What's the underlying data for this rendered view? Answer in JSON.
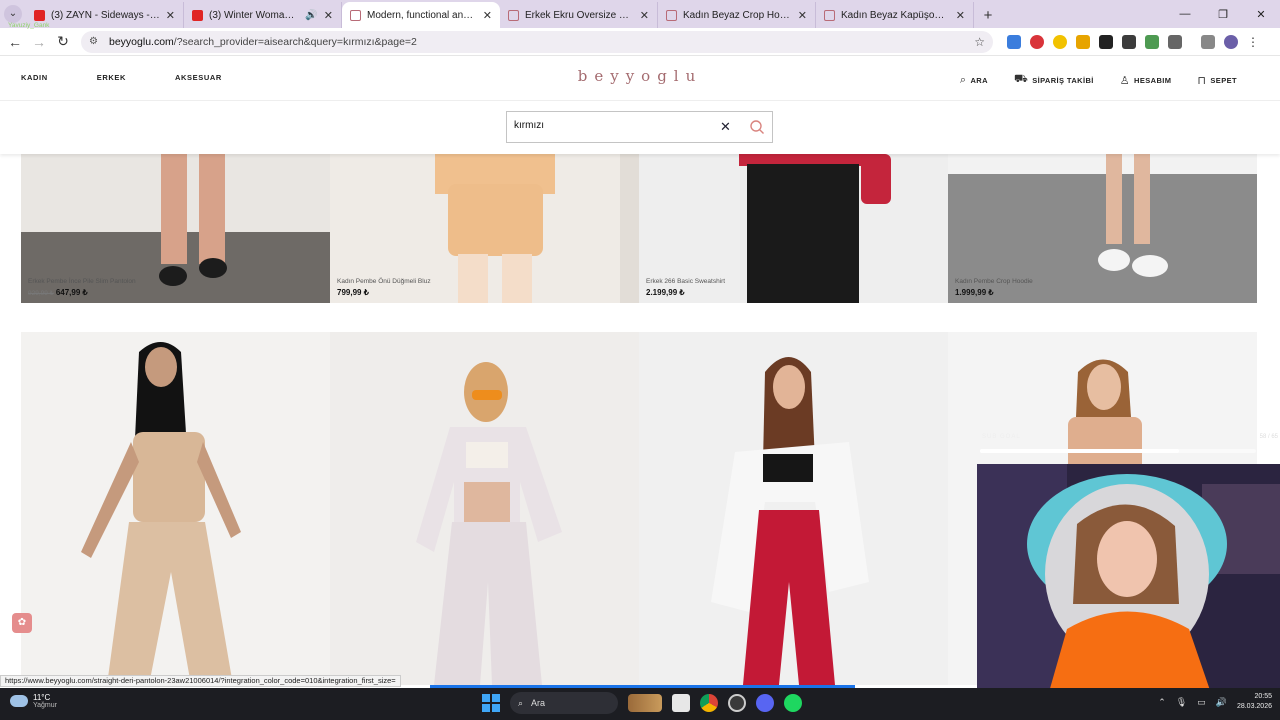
{
  "browser": {
    "tabs": [
      {
        "title": "(3) ZAYN - Sideways - YouTube",
        "favicon": "youtube-icon",
        "active": false,
        "sound": false
      },
      {
        "title": "(3) Winter Woman. - YouTube",
        "favicon": "youtube-icon",
        "active": false,
        "sound": true
      },
      {
        "title": "Modern, functional and cool - beyyoglu",
        "favicon": "beyyoglu-icon",
        "active": true,
        "sound": false
      },
      {
        "title": "Erkek Ekru Oversize Hoodie | Beyyoglu",
        "favicon": "beyyoglu-icon",
        "active": false,
        "sound": false
      },
      {
        "title": "Kadın Beyaz Crop Hoodie | Beyyoglu",
        "favicon": "beyyoglu-icon",
        "active": false,
        "sound": false
      },
      {
        "title": "Kadın Beyaz Kapüşonlu Hoodie",
        "favicon": "beyyoglu-icon",
        "active": false,
        "sound": false
      }
    ],
    "new_tab_label": "+",
    "address": {
      "domain": "beyyoglu.com",
      "path": "/?search_provider=aisearch&query=kırmızı&page=2"
    },
    "status_url": "https://www.beyyoglu.com/straight-deri-pantolon-23aw21006014/?integration_color_code=010&integration_first_size="
  },
  "site": {
    "brand": "beyyoglu",
    "brand_color": "#a46b6f",
    "nav_left": [
      "KADIN",
      "ERKEK",
      "AKSESUAR"
    ],
    "nav_right": {
      "search": "ARA",
      "order_tracking": "SİPARİŞ TAKİBİ",
      "account": "HESABIM",
      "cart": "SEPET"
    },
    "search": {
      "value": "kırmızı"
    }
  },
  "products_row1": [
    {
      "name": "Erkek Pembe İnce Pile Slim Pantolon",
      "old_price": "929,99 ₺",
      "price": "647,99 ₺"
    },
    {
      "name": "Kadın Pembe Önü Düğmeli Bluz",
      "old_price": "",
      "price": "799,99 ₺"
    },
    {
      "name": "Erkek 266 Basic Sweatshirt",
      "old_price": "",
      "price": "2.199,99 ₺"
    },
    {
      "name": "Kadın Pembe Crop Hoodie",
      "old_price": "",
      "price": "1.999,99 ₺"
    }
  ],
  "overlay": {
    "label": "SUB GOAL",
    "count": "58 / 65",
    "progress": 0.72
  },
  "taskbar": {
    "temperature": "11°C",
    "weather": "Yağmur",
    "search_label": "Ara",
    "date": "28.03.2026",
    "time": "20:55",
    "user": "Yavuziy_Gank"
  }
}
